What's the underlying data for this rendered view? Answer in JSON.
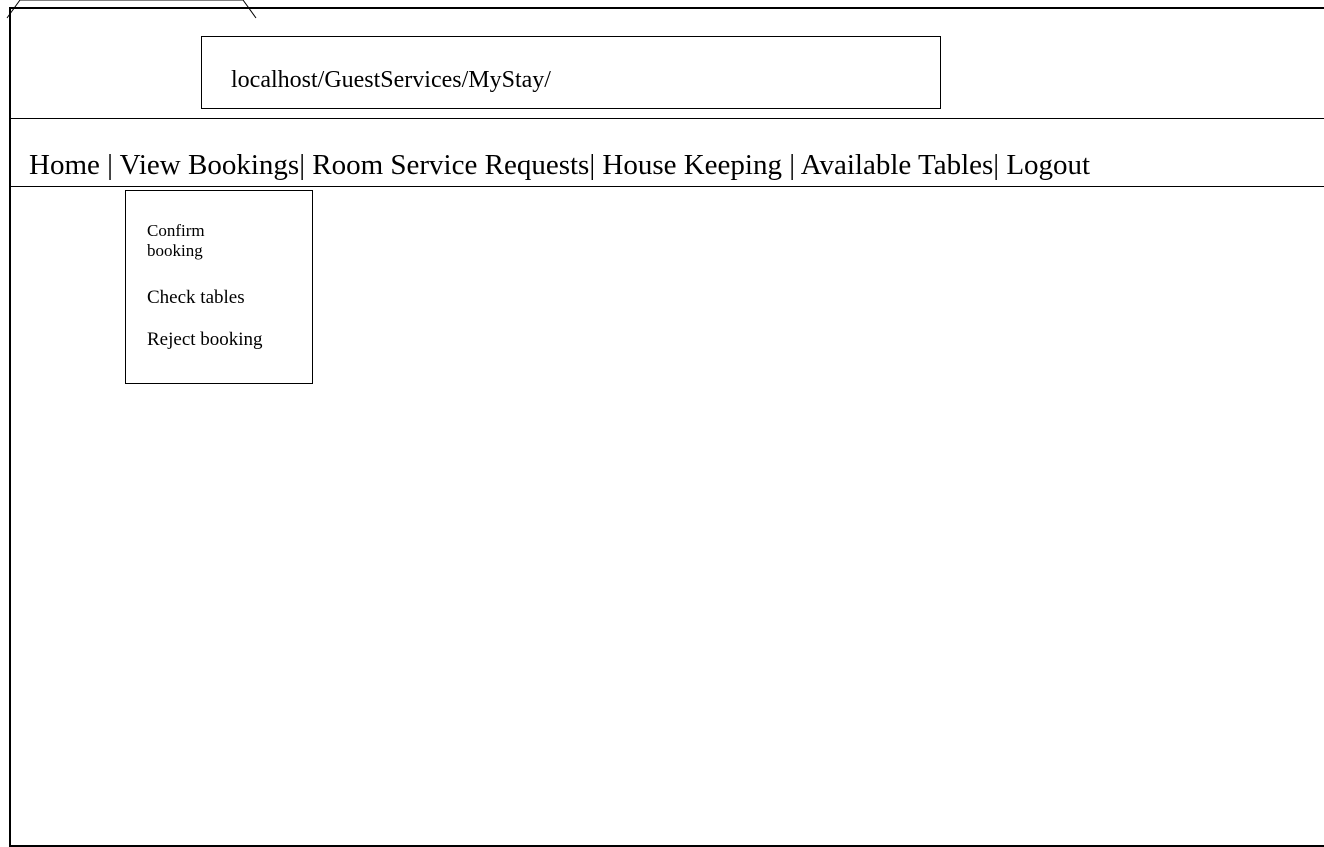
{
  "browser": {
    "address_bar_url": "localhost/GuestServices/MyStay/"
  },
  "nav": {
    "items": [
      {
        "label": "Home"
      },
      {
        "label": "View Bookings"
      },
      {
        "label": "Room Service Requests"
      },
      {
        "label": "House Keeping"
      },
      {
        "label": "Available Tables"
      },
      {
        "label": "Logout"
      }
    ],
    "separators": [
      " | ",
      "| ",
      "| ",
      " | ",
      "| "
    ]
  },
  "dropdown": {
    "items": [
      {
        "label": "Confirm booking"
      },
      {
        "label": "Check tables"
      },
      {
        "label": "Reject booking"
      }
    ]
  }
}
